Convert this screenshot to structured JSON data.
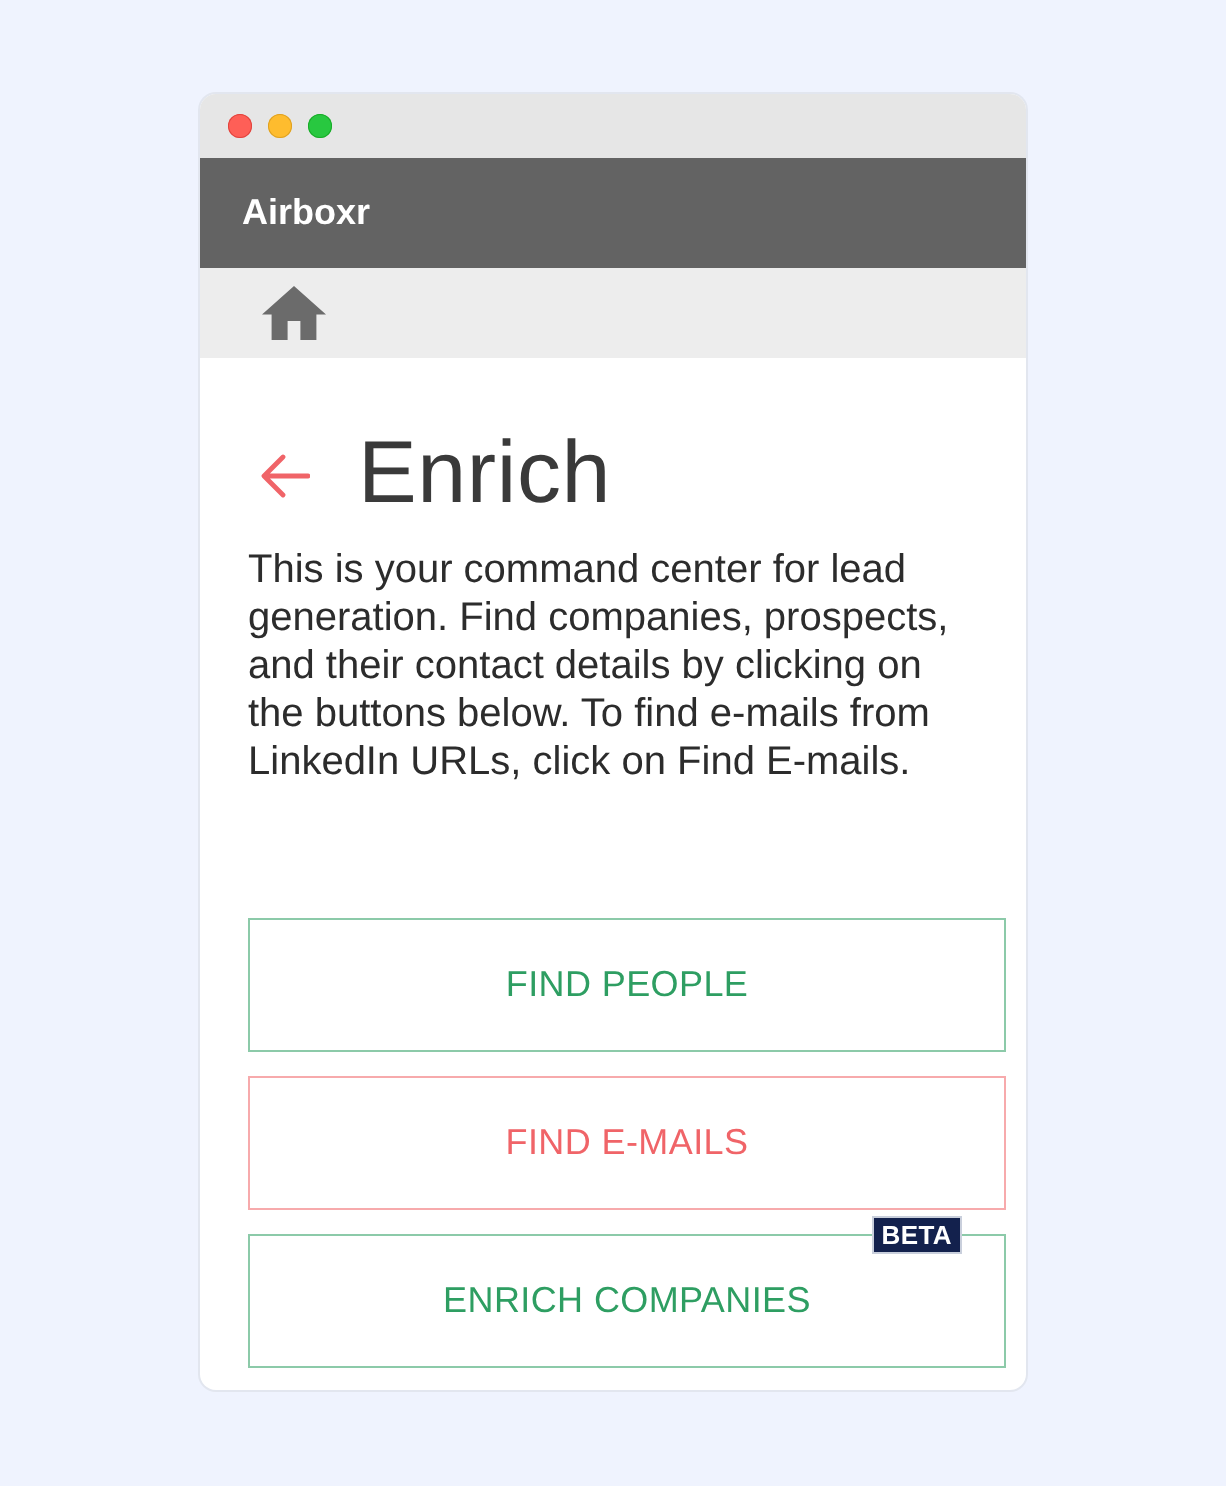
{
  "app_bar": {
    "title": "Airboxr"
  },
  "page": {
    "title": "Enrich",
    "description": "This is your command center for lead generation. Find companies, prospects, and their contact details by clicking on the buttons below. To find e-mails from LinkedIn URLs, click on Find E-mails."
  },
  "buttons": [
    {
      "label": "FIND PEOPLE",
      "color": "#2e9e62"
    },
    {
      "label": "FIND E-MAILS",
      "color": "#f06468"
    },
    {
      "label": "ENRICH COMPANIES",
      "color": "#2e9e62",
      "badge": "BETA"
    }
  ]
}
